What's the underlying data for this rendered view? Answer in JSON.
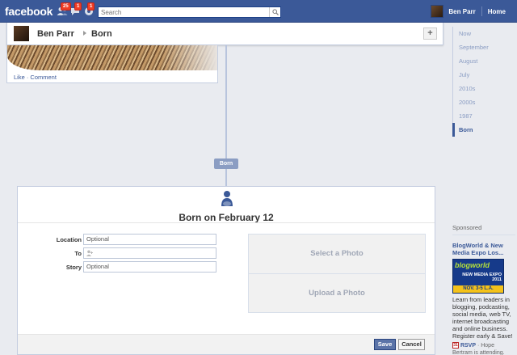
{
  "topbar": {
    "logo": "facebook",
    "jewels": [
      {
        "icon": "friend-requests-icon",
        "count": "25"
      },
      {
        "icon": "messages-icon",
        "count": "1"
      },
      {
        "icon": "notifications-icon",
        "count": "1"
      }
    ],
    "search_placeholder": "Search",
    "user_name": "Ben Parr",
    "home_label": "Home"
  },
  "timeline_header": {
    "name": "Ben Parr",
    "section": "Born",
    "add_label": "+"
  },
  "story": {
    "like_comment": "Like · Comment"
  },
  "spine_marker": "Born",
  "composer": {
    "icon": "baby-icon",
    "title": "Born on February 12",
    "fields": [
      {
        "label": "Location",
        "value": "Optional"
      },
      {
        "label": "To",
        "value": ""
      },
      {
        "label": "Story",
        "value": "Optional"
      }
    ],
    "select_photo": "Select a Photo",
    "upload_photo": "Upload a Photo",
    "save": "Save",
    "cancel": "Cancel"
  },
  "scrubber": {
    "items": [
      "Now",
      "September",
      "August",
      "July",
      "2010s",
      "2000s",
      "1987",
      "Born"
    ],
    "active": "Born"
  },
  "sponsored": {
    "heading": "Sponsored",
    "ad_title": "BlogWorld & New Media Expo Los...",
    "ad_image_text_1": "blogworld",
    "ad_image_text_2": "NEW MEDIA EXPO 2011",
    "ad_image_text_3": "NOV. 3-5 L.A.",
    "ad_body": "Learn from leaders in blogging, podcasting, social media, web TV, internet broadcasting and online business. Register early & Save!",
    "calendar_day": "31",
    "rsvp": "RSVP",
    "rsvp_note": " · Hope Bertram is attending."
  },
  "colors": {
    "brand_blue": "#3b5998",
    "badge_red": "#f03d25",
    "page_bg": "#e9ebf0"
  }
}
